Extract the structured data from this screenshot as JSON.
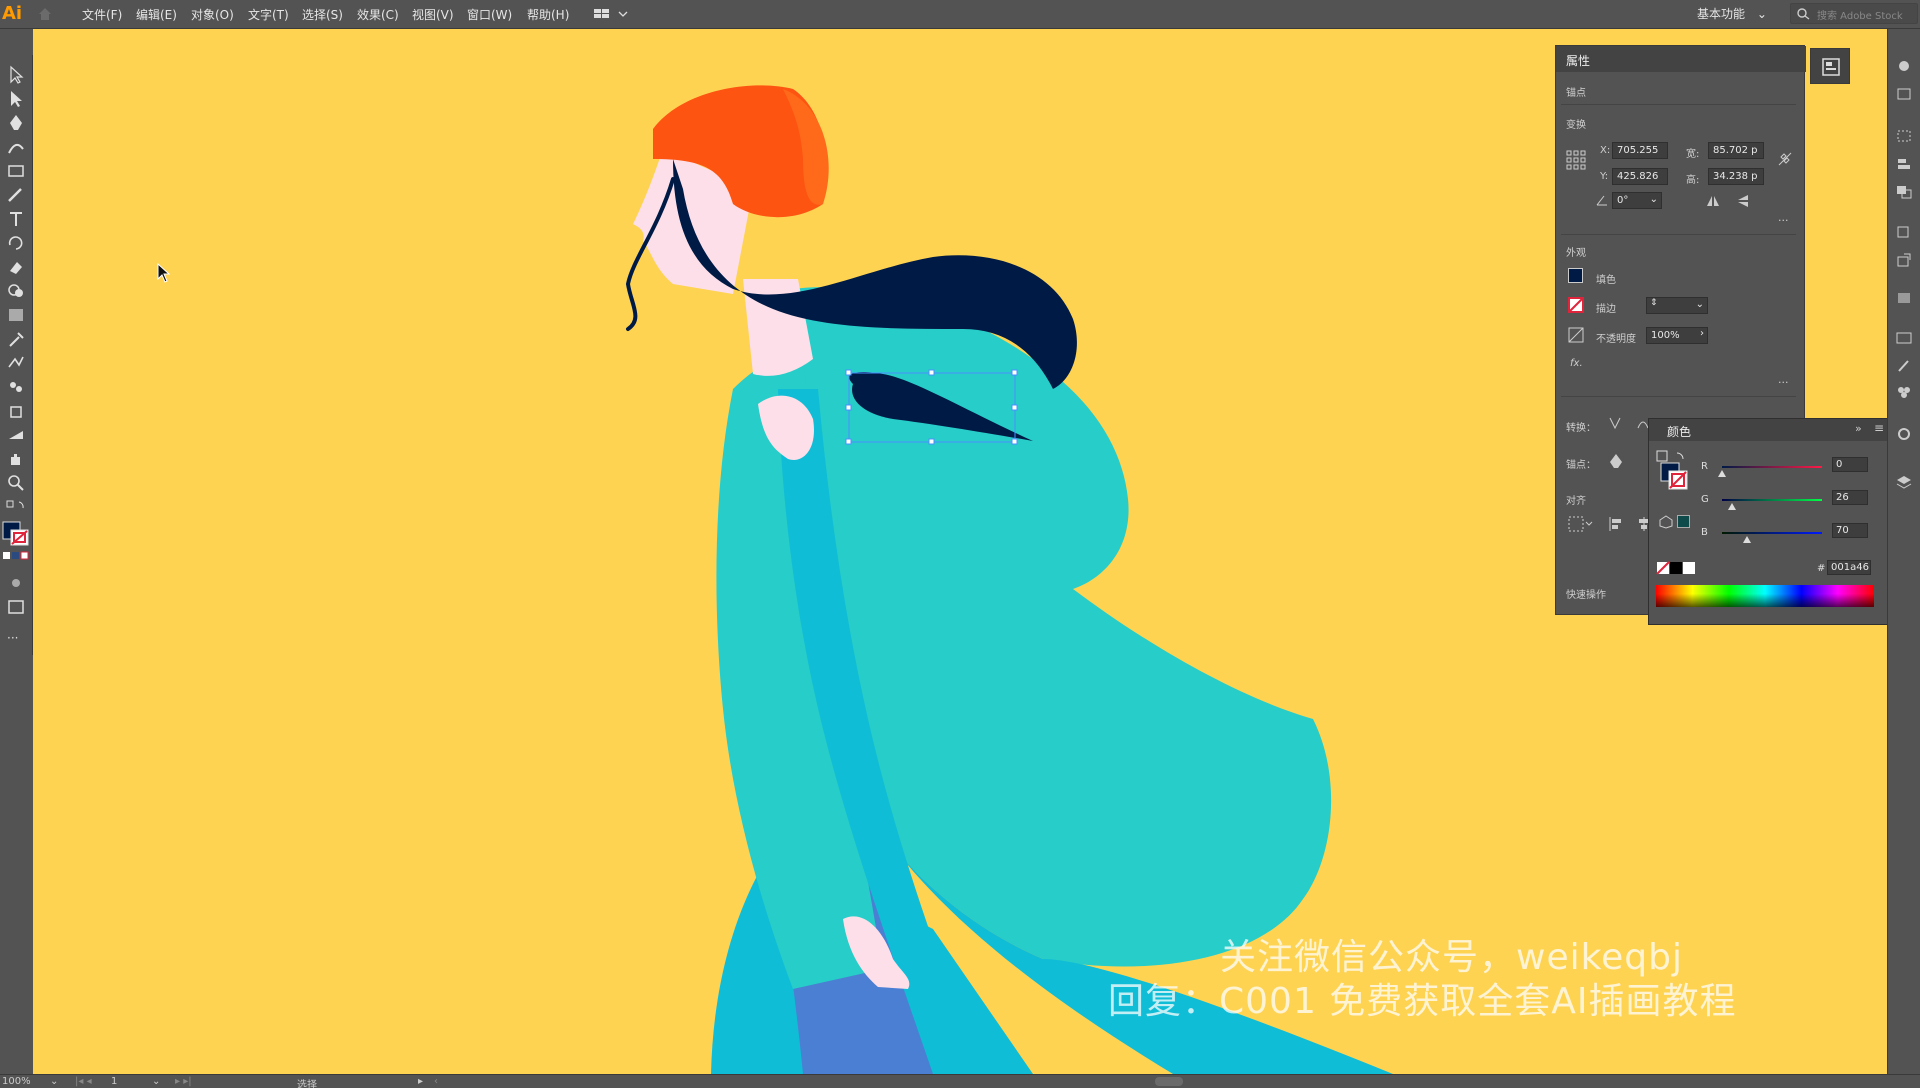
{
  "app": {
    "logo": "Ai"
  },
  "menu": [
    "文件(F)",
    "编辑(E)",
    "对象(O)",
    "文字(T)",
    "选择(S)",
    "效果(C)",
    "视图(V)",
    "窗口(W)",
    "帮助(H)"
  ],
  "workspace": {
    "label": "基本功能"
  },
  "search": {
    "placeholder": "搜索 Adobe Stock"
  },
  "properties": {
    "tab": "属性",
    "anchor_section": "锚点",
    "transform_section": "变换",
    "x_label": "X:",
    "x_value": "705.255",
    "y_label": "Y:",
    "y_value": "425.826",
    "w_label": "宽:",
    "w_value": "85.702 p",
    "h_label": "高:",
    "h_value": "34.238 p",
    "angle_value": "0°",
    "appearance_section": "外观",
    "fill_label": "填色",
    "stroke_label": "描边",
    "opacity_label": "不透明度",
    "opacity_value": "100%",
    "fx_label": "fx.",
    "convert_label": "转换：",
    "anchor_label": "锚点：",
    "align_section": "对齐",
    "quick_actions": "快速操作"
  },
  "color_panel": {
    "tab": "颜色",
    "r_label": "R",
    "r_value": "0",
    "g_label": "G",
    "g_value": "26",
    "b_label": "B",
    "b_value": "70",
    "hex_label": "#",
    "hex_value": "001a46"
  },
  "status": {
    "zoom": "100%",
    "artboard": "1",
    "tool": "选择"
  },
  "watermark": {
    "line1": "关注微信公众号，weikeqbj",
    "line2": "回复：C001      免费获取全套AI插画教程"
  },
  "colors": {
    "canvas_bg": "#fed352",
    "coat": "#27cdc8",
    "coat_shadow": "#0fbdd6",
    "dress": "#4a7fd3",
    "hat": "#fd5411",
    "hair": "#001a46",
    "skin": "#fcdfe9"
  }
}
